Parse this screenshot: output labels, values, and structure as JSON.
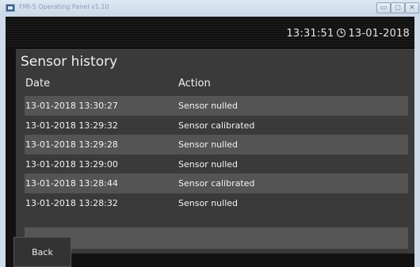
{
  "window": {
    "title": "FMI-5 Operating Panel v1.10",
    "controls": {
      "minimize": "▭",
      "maximize": "◻",
      "close": "✕"
    }
  },
  "header": {
    "time": "13:31:51",
    "date": "13-01-2018",
    "clock_icon": "clock-icon"
  },
  "panel": {
    "title": "Sensor history",
    "columns": {
      "date": "Date",
      "action": "Action"
    },
    "rows": [
      {
        "date": "13-01-2018 13:30:27",
        "action": "Sensor nulled"
      },
      {
        "date": "13-01-2018 13:29:32",
        "action": "Sensor calibrated"
      },
      {
        "date": "13-01-2018 13:29:28",
        "action": "Sensor nulled"
      },
      {
        "date": "13-01-2018 13:29:00",
        "action": "Sensor nulled"
      },
      {
        "date": "13-01-2018 13:28:44",
        "action": "Sensor calibrated"
      },
      {
        "date": "13-01-2018 13:28:32",
        "action": "Sensor nulled"
      }
    ]
  },
  "footer": {
    "back_label": "Back"
  },
  "colors": {
    "background": "#121212",
    "panel": "#3a3a3a",
    "row_alt": "#545454",
    "text": "#f0f0f0"
  }
}
